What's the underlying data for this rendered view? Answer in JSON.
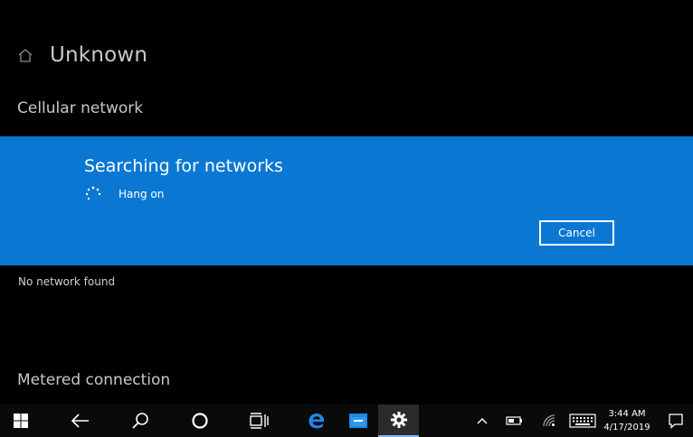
{
  "header": {
    "title": "Unknown",
    "home_icon": "home-icon"
  },
  "sections": {
    "cellular": "Cellular network",
    "metered": "Metered connection"
  },
  "dialog": {
    "title": "Searching for networks",
    "progress_text": "Hang on",
    "cancel_label": "Cancel",
    "background_color": "#0a78d2"
  },
  "status": {
    "no_network": "No network found"
  },
  "taskbar": {
    "icons": [
      "windows-start-icon",
      "back-arrow-icon",
      "search-icon",
      "cortana-icon",
      "task-view-icon",
      "edge-icon",
      "file-explorer-icon",
      "settings-icon",
      "show-hidden-icons-chevron",
      "battery-icon",
      "wifi-icon",
      "touch-keyboard-icon",
      "action-center-icon"
    ],
    "time": "3:44 AM",
    "date": "4/17/2019"
  }
}
